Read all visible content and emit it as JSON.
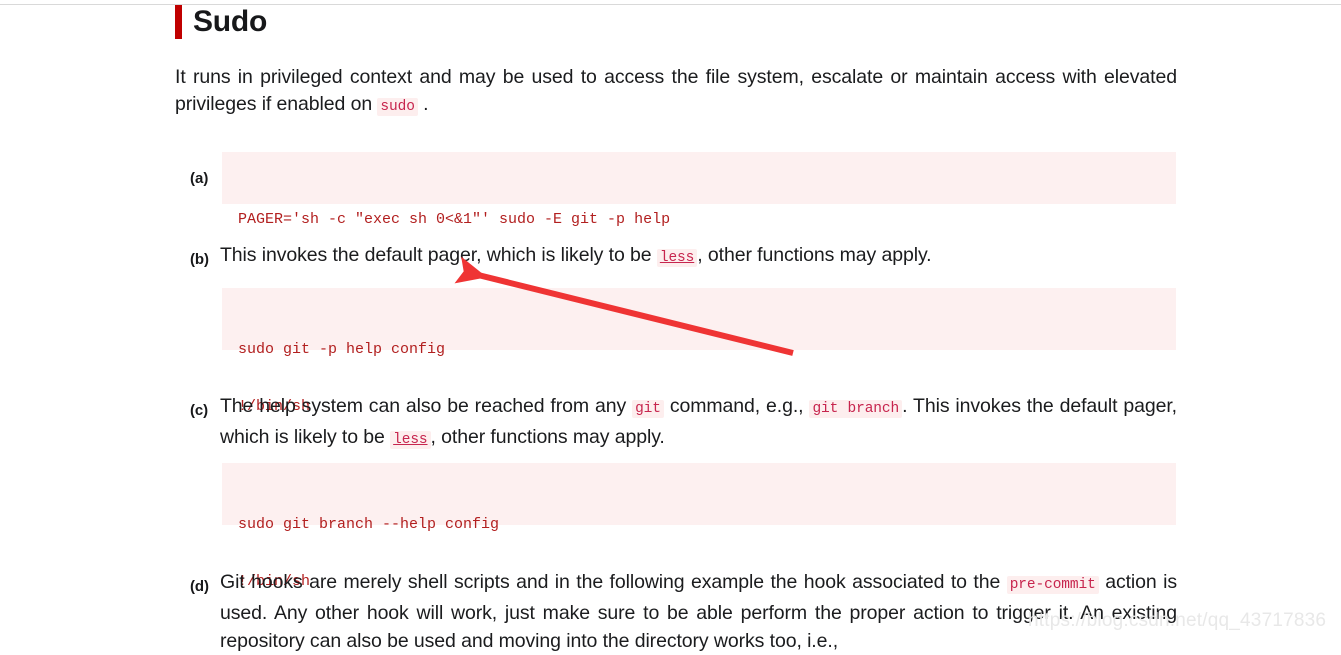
{
  "heading": {
    "title": "Sudo",
    "accent_color": "#c00000"
  },
  "intro": {
    "before_code": "It runs in privileged context and may be used to access the file system, escalate or maintain access with elevated privileges if enabled on ",
    "code": "sudo",
    "after_code": " ."
  },
  "items": [
    {
      "label": "(a)",
      "type": "code",
      "lines": [
        "PAGER='sh -c \"exec sh 0<&1\"' sudo -E git -p help"
      ]
    },
    {
      "label": "(b)",
      "type": "text",
      "segments": [
        {
          "kind": "text",
          "value": "This invokes the default pager, which is likely to be "
        },
        {
          "kind": "code-link",
          "value": "less"
        },
        {
          "kind": "text",
          "value": ", other functions may apply."
        }
      ]
    },
    {
      "label": "",
      "type": "code",
      "lines": [
        "sudo git -p help config",
        "!/bin/sh"
      ]
    },
    {
      "label": "(c)",
      "type": "text",
      "segments": [
        {
          "kind": "text",
          "value": "The help system can also be reached from any "
        },
        {
          "kind": "code",
          "value": "git"
        },
        {
          "kind": "text",
          "value": " command, e.g., "
        },
        {
          "kind": "code",
          "value": "git branch"
        },
        {
          "kind": "text",
          "value": ". This invokes the default pager, which is likely to be "
        },
        {
          "kind": "code-link",
          "value": "less"
        },
        {
          "kind": "text",
          "value": ", other functions may apply."
        }
      ]
    },
    {
      "label": "",
      "type": "code",
      "lines": [
        "sudo git branch --help config",
        "!/bin/sh"
      ]
    },
    {
      "label": "(d)",
      "type": "text",
      "segments": [
        {
          "kind": "text",
          "value": "Git hooks are merely shell scripts and in the following example the hook associated to the "
        },
        {
          "kind": "code",
          "value": "pre-commit"
        },
        {
          "kind": "text",
          "value": " action is used. Any other hook will work, just make sure to be able perform the proper action to trigger it. An existing repository can also be used and moving into the directory works too, i.e.,"
        }
      ]
    }
  ],
  "annotation": {
    "arrow_color": "#ef3434",
    "arrow_name": "red-pointer-arrow"
  },
  "watermark": {
    "text": "https://blog.csdn.net/qq_43717836"
  },
  "colors": {
    "code_block_bg": "#fdf0f0",
    "code_text": "#b21f1f",
    "inline_code_bg": "#fdeeee",
    "inline_code_text": "#c7254e",
    "body_text": "#1b1c1e"
  }
}
